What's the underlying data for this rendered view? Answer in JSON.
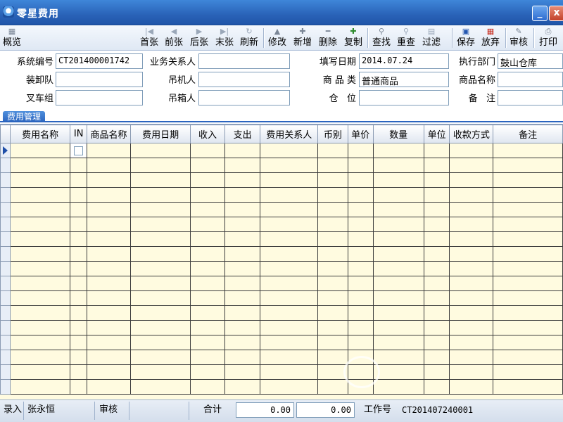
{
  "window": {
    "title": "零星费用",
    "minimize_glyph": "_",
    "close_glyph": "x"
  },
  "toolbar": {
    "overview": {
      "label": "概览",
      "icon": "grid-icon"
    },
    "first": {
      "label": "首张",
      "icon": "first-record-icon",
      "glyph": "|◀"
    },
    "prev": {
      "label": "前张",
      "icon": "prev-record-icon",
      "glyph": "◀"
    },
    "next": {
      "label": "后张",
      "icon": "next-record-icon",
      "glyph": "▶"
    },
    "last": {
      "label": "末张",
      "icon": "last-record-icon",
      "glyph": "▶|"
    },
    "refresh": {
      "label": "刷新",
      "icon": "refresh-icon",
      "glyph": "↻"
    },
    "edit": {
      "label": "修改",
      "icon": "edit-icon",
      "glyph": "▲"
    },
    "add": {
      "label": "新增",
      "icon": "plus-icon",
      "glyph": "✚"
    },
    "delete": {
      "label": "删除",
      "icon": "minus-icon",
      "glyph": "━"
    },
    "copy": {
      "label": "复制",
      "icon": "copy-icon",
      "glyph": "✚"
    },
    "find": {
      "label": "查找",
      "icon": "binoculars-icon",
      "glyph": "⚲"
    },
    "recheck": {
      "label": "重查",
      "icon": "binoculars-icon",
      "glyph": "⚲"
    },
    "filter": {
      "label": "过滤",
      "icon": "filter-icon",
      "glyph": "▤"
    },
    "save": {
      "label": "保存",
      "icon": "save-icon",
      "glyph": "▣"
    },
    "discard": {
      "label": "放弃",
      "icon": "discard-icon",
      "glyph": "▦"
    },
    "audit": {
      "label": "审核",
      "icon": "audit-icon",
      "glyph": "✎"
    },
    "print": {
      "label": "打印",
      "icon": "printer-icon",
      "glyph": "⎙"
    }
  },
  "form": {
    "system_no": {
      "label": "系统编号",
      "value": "CT201400001742"
    },
    "business_contact": {
      "label": "业务关系人",
      "value": ""
    },
    "fill_date": {
      "label": "填写日期",
      "value": "2014.07.24"
    },
    "exec_dept": {
      "label": "执行部门",
      "value": "鼓山仓库"
    },
    "loading_team": {
      "label": "装卸队",
      "value": ""
    },
    "crane_operator": {
      "label": "吊机人",
      "value": ""
    },
    "goods_category": {
      "label": "商 品 类",
      "value": "普通商品"
    },
    "goods_name": {
      "label": "商品名称",
      "value": ""
    },
    "forklift_group": {
      "label": "叉车组",
      "value": ""
    },
    "box_lifter": {
      "label": "吊箱人",
      "value": ""
    },
    "location": {
      "label": "仓   位",
      "value": ""
    },
    "remark": {
      "label": "备   注",
      "value": ""
    }
  },
  "section": {
    "title": "费用管理"
  },
  "grid": {
    "columns": [
      "费用名称",
      "IN",
      "商品名称",
      "费用日期",
      "收入",
      "支出",
      "费用关系人",
      "币别",
      "单价",
      "数量",
      "单位",
      "收款方式",
      "备注"
    ]
  },
  "status": {
    "entry_label": "录入",
    "entry_user": "张永恒",
    "audit_label": "审核",
    "audit_user": "",
    "total_label": "合计",
    "total_income": "0.00",
    "total_expense": "0.00",
    "job_no_label": "工作号",
    "job_no": "CT201407240001"
  }
}
